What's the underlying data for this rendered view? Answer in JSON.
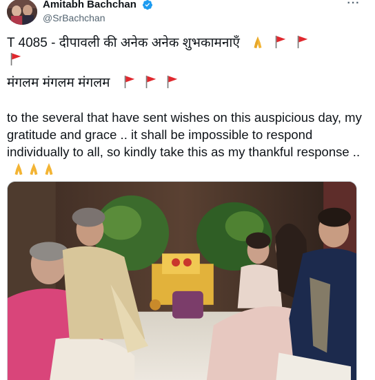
{
  "user": {
    "display_name": "Amitabh Bachchan",
    "handle": "@SrBachchan",
    "verified": true,
    "verified_color": "#1d9bf0"
  },
  "tweet": {
    "line1": "T 4085 - दीपावली की अनेक अनेक शुभकामनाएँ",
    "line2": "मंगलम मंगलम मंगलम",
    "line3": "to the several that have sent wishes on this auspicious day, my gratitude and grace .. it shall be impossible to respond individually to all, so kindly take this as my thankful response .."
  },
  "icons": {
    "more": "more-dots-icon",
    "flag": "triangular-flag-icon",
    "pray": "folded-hands-icon",
    "verified": "verified-badge-icon"
  },
  "colors": {
    "text": "#0f1419",
    "secondary": "#536471",
    "flag_red": "#e0282e"
  }
}
